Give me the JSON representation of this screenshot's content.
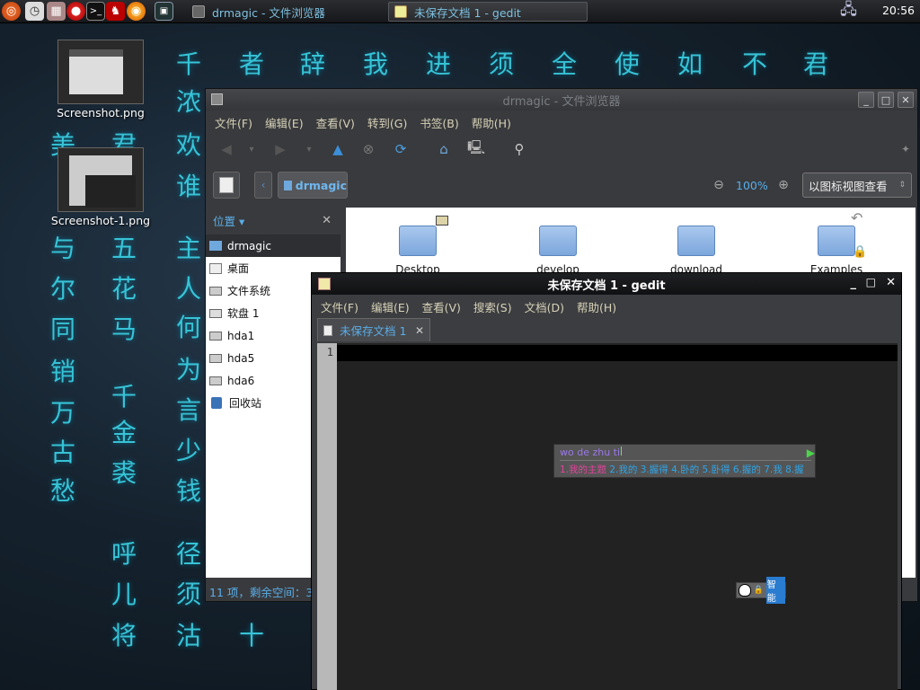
{
  "panel": {
    "clock": "20:56",
    "tasks": [
      {
        "title": "drmagic - 文件浏览器"
      },
      {
        "title": "未保存文档 1 - gedit"
      }
    ]
  },
  "desktop": {
    "icons": [
      {
        "label": "Screenshot.png"
      },
      {
        "label": "Screenshot-1.png"
      }
    ],
    "calligraphy": [
      "千",
      "者",
      "辞",
      "我",
      "进",
      "须",
      "全",
      "使",
      "如",
      "不",
      "君",
      "浓",
      "欢",
      "谁",
      "主",
      "人",
      "何",
      "为",
      "言",
      "少",
      "钱",
      "美",
      "君",
      "与",
      "五",
      "尔",
      "花",
      "同",
      "马",
      "销",
      "千",
      "万",
      "金",
      "古",
      "裘",
      "愁",
      "呼",
      "儿",
      "将",
      "径",
      "须",
      "沽",
      "十"
    ]
  },
  "file_manager": {
    "title": "drmagic - 文件浏览器",
    "menu": [
      "文件(F)",
      "编辑(E)",
      "查看(V)",
      "转到(G)",
      "书签(B)",
      "帮助(H)"
    ],
    "location": "drmagic",
    "zoom": "100%",
    "view_mode": "以图标视图查看",
    "side_pane_title": "位置",
    "places": [
      "drmagic",
      "桌面",
      "文件系统",
      "软盘 1",
      "hda1",
      "hda5",
      "hda6",
      "回收站"
    ],
    "files": [
      "Desktop",
      "develop",
      "download",
      "Examples"
    ],
    "status": "11 项，剩余空间：3."
  },
  "gedit": {
    "title": "未保存文档 1 - gedit",
    "menu": [
      "文件(F)",
      "编辑(E)",
      "查看(V)",
      "搜索(S)",
      "文档(D)",
      "帮助(H)"
    ],
    "tab_label": "未保存文档 1",
    "line_number": "1",
    "ime": {
      "preedit": "wo de zhu ti",
      "candidates": [
        "1.我的主题",
        "2.我的",
        "3.握得",
        "4.卧的",
        "5.卧得",
        "6.握的",
        "7.我",
        "8.握"
      ],
      "status_label": "智能"
    }
  },
  "colors": {
    "callig": "#37c3d6",
    "menu_text": "#d7d2b8",
    "candidate_text": "#e0449a",
    "gedit_bg": "#222222"
  }
}
